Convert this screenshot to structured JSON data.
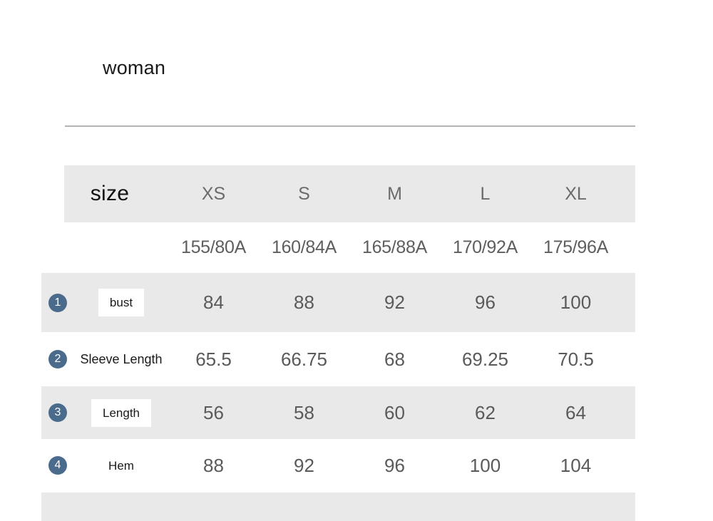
{
  "title": "woman",
  "table": {
    "size_header_label": "size",
    "size_labels": [
      "XS",
      "S",
      "M",
      "L",
      "XL"
    ],
    "size_codes": [
      "155/80A",
      "160/84A",
      "165/88A",
      "170/92A",
      "175/96A"
    ],
    "accent_color": "#4b6b8c",
    "stripe_color": "#e9e9e9",
    "rows": [
      {
        "badge": "1",
        "label": "bust",
        "label_style": "boxed",
        "striped": true,
        "values": [
          "84",
          "88",
          "92",
          "96",
          "100"
        ]
      },
      {
        "badge": "2",
        "label": "Sleeve Length",
        "label_style": "plain",
        "striped": false,
        "values": [
          "65.5",
          "66.75",
          "68",
          "69.25",
          "70.5"
        ]
      },
      {
        "badge": "3",
        "label": "Length",
        "label_style": "boxed",
        "striped": true,
        "values": [
          "56",
          "58",
          "60",
          "62",
          "64"
        ]
      },
      {
        "badge": "4",
        "label": "Hem",
        "label_style": "plain",
        "striped": false,
        "values": [
          "88",
          "92",
          "96",
          "100",
          "104"
        ]
      }
    ]
  }
}
